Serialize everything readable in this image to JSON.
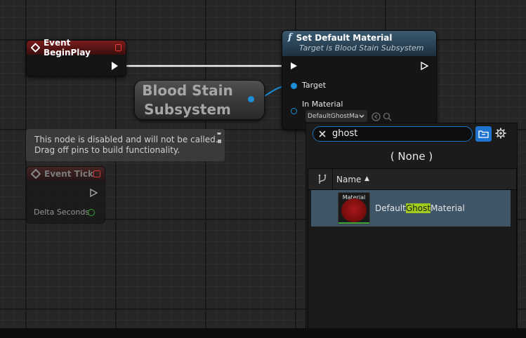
{
  "nodes": {
    "begin_play": {
      "title": "Event BeginPlay"
    },
    "set_material": {
      "title": "Set Default Material",
      "subtitle": "Target is Blood Stain Subsystem",
      "function_glyph": "f",
      "pin_target": "Target",
      "pin_in_material": "In Material",
      "material_combo": "DefaultGhostMa"
    },
    "subsystem": {
      "line1": "Blood Stain",
      "line2": "Subsystem"
    },
    "event_tick": {
      "title": "Event Tick",
      "pin_delta": "Delta Seconds"
    }
  },
  "disabled_tooltip": {
    "line1": "This node is disabled and will not be called.",
    "line2": "Drag off pins to build functionality."
  },
  "asset_picker": {
    "search_value": "ghost",
    "none_label": "( None )",
    "column_name": "Name",
    "sort_indicator": "▲",
    "asset": {
      "thumb_label": "Material",
      "name_prefix": "Default",
      "name_match": "Ghost",
      "name_suffix": "Material"
    }
  },
  "colors": {
    "exec_pin": "#ffffff",
    "object_pin": "#1a8fd6",
    "float_pin": "#2fb52f",
    "event_header": "#7a1c1c",
    "function_header": "#3a5a70",
    "selection": "#3f5568",
    "search_highlight": "#a2cc1c"
  },
  "icons": [
    "event-diamond-icon",
    "function-icon",
    "clear-search-icon",
    "folder-icon",
    "settings-icon",
    "filter-icon",
    "browse-arrow-icon",
    "search-icon",
    "pin-icon"
  ]
}
